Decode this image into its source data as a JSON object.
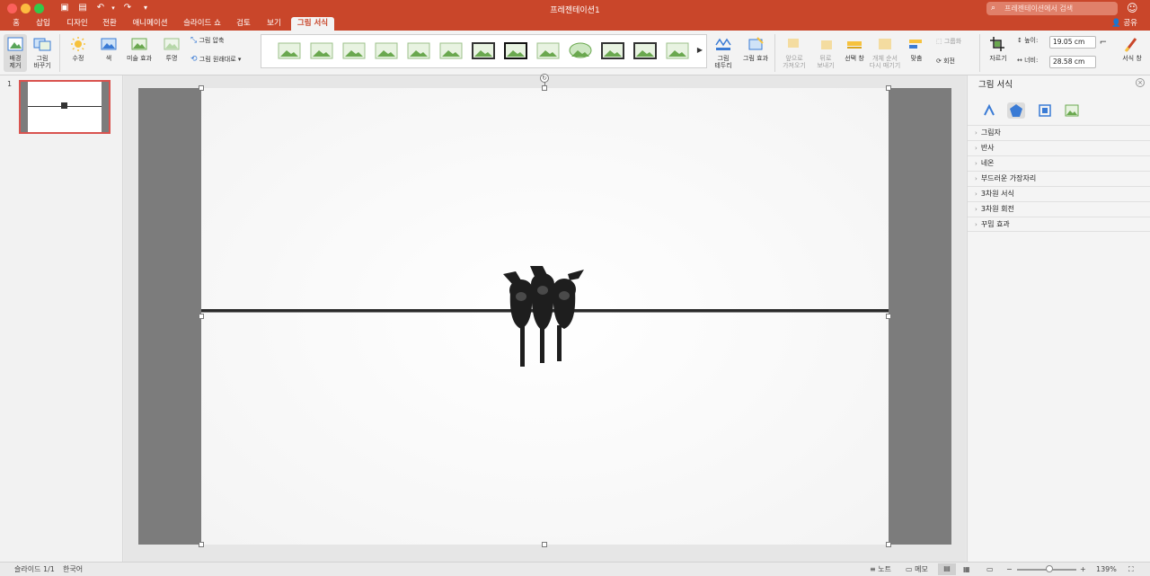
{
  "window": {
    "title": "프레젠테이션1"
  },
  "search": {
    "placeholder": "프레젠테이션에서 검색"
  },
  "tabs": [
    {
      "label": "홈"
    },
    {
      "label": "삽입"
    },
    {
      "label": "디자인"
    },
    {
      "label": "전환"
    },
    {
      "label": "애니메이션"
    },
    {
      "label": "슬라이드 쇼"
    },
    {
      "label": "검토"
    },
    {
      "label": "보기"
    },
    {
      "label": "그림 서식",
      "active": true
    }
  ],
  "share": {
    "label": "공유"
  },
  "ribbon": {
    "remove_bg": "배경\n제거",
    "change_picture": "그림\n바꾸기",
    "corrections": "수정",
    "color": "색",
    "artistic": "미술 효과",
    "transparency": "투명",
    "compress": "그림 압축",
    "reset": "그림 원래대로",
    "border": "그림\n테두리",
    "effects": "그림 효과",
    "bring_forward": "앞으로\n가져오기",
    "send_backward": "뒤로\n보내기",
    "selection_pane": "선택 창",
    "reorder": "개체 순서\n다시 매기기",
    "align": "맞춤",
    "group": "그룹화",
    "rotate": "회전",
    "crop": "자르기",
    "height_label": "높이:",
    "height_value": "19.05 cm",
    "width_label": "너비:",
    "width_value": "28.58 cm",
    "format_pane": "서식 창"
  },
  "slides": {
    "number": "1"
  },
  "format_pane": {
    "title": "그림 서식",
    "sections": [
      {
        "label": "그림자"
      },
      {
        "label": "반사"
      },
      {
        "label": "네온"
      },
      {
        "label": "부드러운 가장자리"
      },
      {
        "label": "3차원 서식"
      },
      {
        "label": "3차원 회전"
      },
      {
        "label": "꾸밈 효과"
      }
    ]
  },
  "status": {
    "slide": "슬라이드 1/1",
    "language": "한국어",
    "notes": "노트",
    "comments": "메모",
    "zoom": "139%"
  },
  "colors": {
    "accent": "#c9462a",
    "selection": "#d9534f"
  }
}
